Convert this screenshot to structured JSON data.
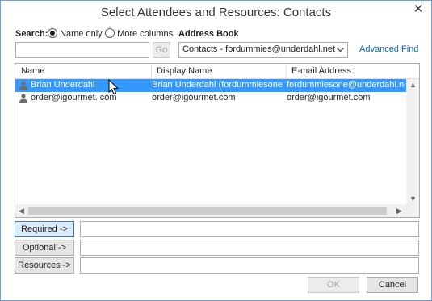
{
  "window": {
    "title": "Select Attendees and Resources: Contacts",
    "close_glyph": "✕"
  },
  "search": {
    "label": "Search:",
    "option_name_only": "Name only",
    "option_more_columns": "More columns",
    "selected_option": "Name only",
    "input_value": "",
    "go_label": "Go"
  },
  "address_book": {
    "label": "Address Book",
    "selected": "Contacts - fordummies@underdahl.net",
    "advanced_find": "Advanced Find"
  },
  "list": {
    "columns": [
      "Name",
      "Display Name",
      "E-mail Address"
    ],
    "rows": [
      {
        "name": "Brian Underdahl",
        "display_name": "Brian Underdahl (fordummiesone...",
        "email": "fordummiesone@underdahl.net",
        "selected": true
      },
      {
        "name": "order@igourmet. com",
        "display_name": "order@igourmet.com",
        "email": "order@igourmet.com",
        "selected": false
      }
    ]
  },
  "recipients": {
    "required_label": "Required ->",
    "optional_label": "Optional ->",
    "resources_label": "Resources ->",
    "required_value": "",
    "optional_value": "",
    "resources_value": ""
  },
  "footer": {
    "ok_label": "OK",
    "cancel_label": "Cancel"
  },
  "colors": {
    "selection": "#3399ff",
    "link": "#0e63b6",
    "window_border": "#6f9fd8"
  }
}
